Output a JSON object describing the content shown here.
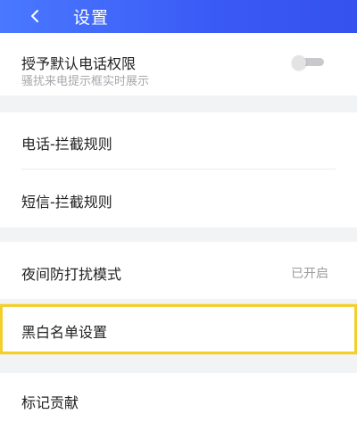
{
  "header": {
    "title": "设置",
    "back_icon": "chevron-left-icon",
    "gradient_start": "#4a78ff",
    "gradient_end": "#3551ee"
  },
  "phone_permission": {
    "label": "授予默认电话权限",
    "sublabel": "骚扰来电提示框实时展示",
    "toggle_on": false
  },
  "call_block": {
    "label": "电话-拦截规则"
  },
  "sms_block": {
    "label": "短信-拦截规则"
  },
  "night_mode": {
    "label": "夜间防打扰模式",
    "value": "已开启"
  },
  "blacklist": {
    "label": "黑白名单设置",
    "highlight_color": "#f3cf2e"
  },
  "mark_contribution": {
    "label": "标记贡献"
  }
}
